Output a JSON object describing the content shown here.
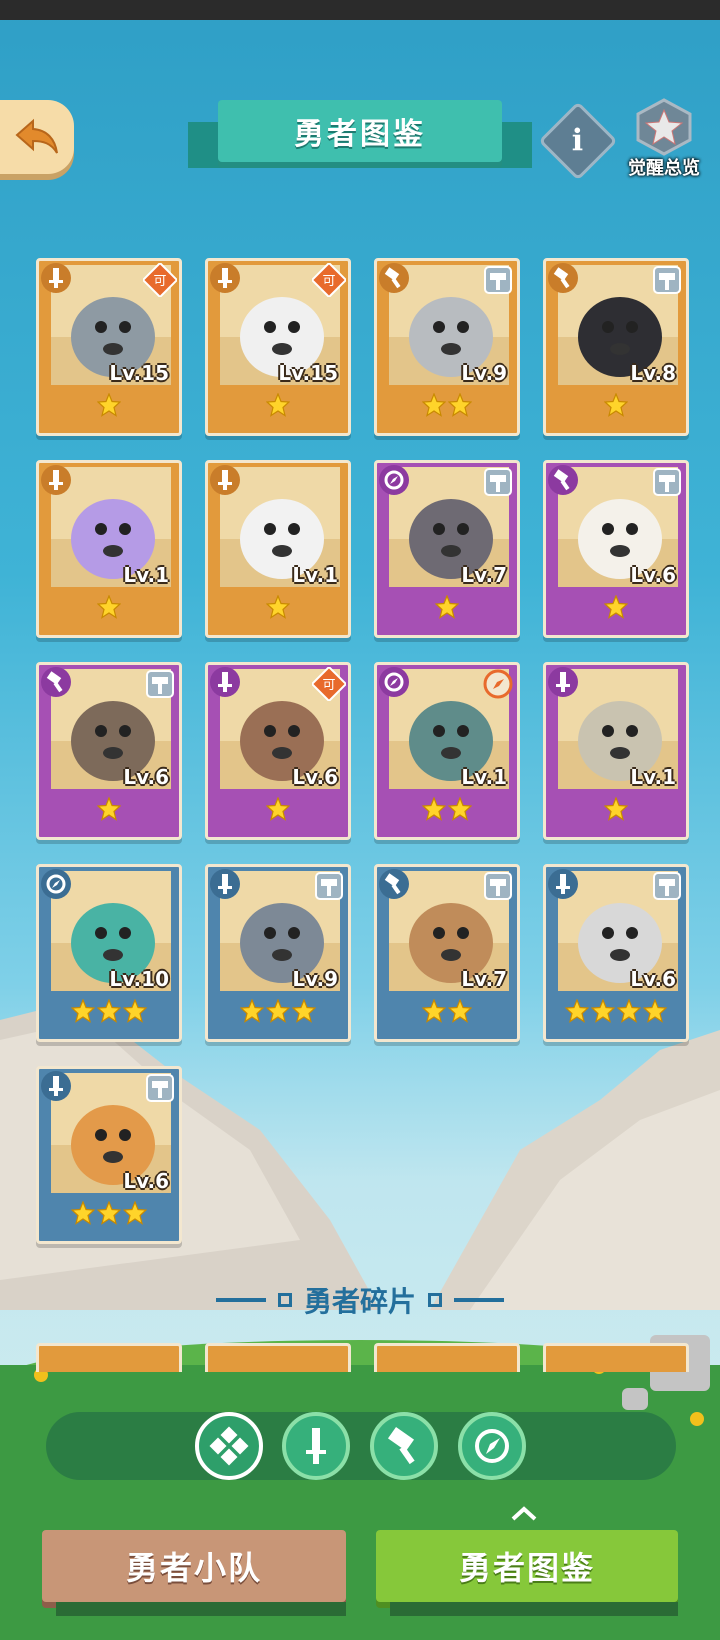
{
  "header": {
    "title": "勇者图鉴",
    "awaken_label": "觉醒总览",
    "info_label": "i"
  },
  "colors": {
    "orange_card": "#e29a3c",
    "purple_card": "#a650b4",
    "blue_card": "#4f85ad",
    "accent_teal": "#3fbfae",
    "active_tab_green": "#86c83a"
  },
  "heroes": [
    {
      "level": "Lv.15",
      "stars": 1,
      "rarity": "orange",
      "class_icon": "sword-icon",
      "tag_icon": "shield-badge-icon"
    },
    {
      "level": "Lv.15",
      "stars": 1,
      "rarity": "orange",
      "class_icon": "sword-icon",
      "tag_icon": "shield-badge-icon"
    },
    {
      "level": "Lv.9",
      "stars": 2,
      "rarity": "orange",
      "class_icon": "hammer-icon",
      "tag_icon": "hammer-badge-icon"
    },
    {
      "level": "Lv.8",
      "stars": 1,
      "rarity": "orange",
      "class_icon": "hammer-icon",
      "tag_icon": "hammer-badge-icon"
    },
    {
      "level": "Lv.1",
      "stars": 1,
      "rarity": "orange",
      "class_icon": "sword-icon",
      "tag_icon": ""
    },
    {
      "level": "Lv.1",
      "stars": 1,
      "rarity": "orange",
      "class_icon": "sword-icon",
      "tag_icon": ""
    },
    {
      "level": "Lv.7",
      "stars": 1,
      "rarity": "purple",
      "class_icon": "compass-icon",
      "tag_icon": "hammer-badge-icon"
    },
    {
      "level": "Lv.6",
      "stars": 1,
      "rarity": "purple",
      "class_icon": "hammer-icon",
      "tag_icon": "hammer-badge-icon"
    },
    {
      "level": "Lv.6",
      "stars": 1,
      "rarity": "purple",
      "class_icon": "hammer-icon",
      "tag_icon": "hammer-badge-icon"
    },
    {
      "level": "Lv.6",
      "stars": 1,
      "rarity": "purple",
      "class_icon": "sword-icon",
      "tag_icon": "shield-badge-icon"
    },
    {
      "level": "Lv.1",
      "stars": 2,
      "rarity": "purple",
      "class_icon": "compass-icon",
      "tag_icon": "compass-badge-icon"
    },
    {
      "level": "Lv.1",
      "stars": 1,
      "rarity": "purple",
      "class_icon": "sword-icon",
      "tag_icon": ""
    },
    {
      "level": "Lv.10",
      "stars": 3,
      "rarity": "blue",
      "class_icon": "compass-icon",
      "tag_icon": ""
    },
    {
      "level": "Lv.9",
      "stars": 3,
      "rarity": "blue",
      "class_icon": "sword-icon",
      "tag_icon": "hammer-badge-icon"
    },
    {
      "level": "Lv.7",
      "stars": 2,
      "rarity": "blue",
      "class_icon": "hammer-icon",
      "tag_icon": "hammer-badge-icon"
    },
    {
      "level": "Lv.6",
      "stars": 4,
      "rarity": "blue",
      "class_icon": "sword-icon",
      "tag_icon": "hammer-badge-icon"
    },
    {
      "level": "Lv.6",
      "stars": 3,
      "rarity": "blue",
      "class_icon": "sword-icon",
      "tag_icon": "hammer-badge-icon"
    }
  ],
  "shards": {
    "title": "勇者碎片"
  },
  "filters": [
    {
      "icon": "all-classes-icon",
      "active": true
    },
    {
      "icon": "sword-icon",
      "active": false
    },
    {
      "icon": "hammer-icon",
      "active": false
    },
    {
      "icon": "compass-icon",
      "active": false
    }
  ],
  "bottom_nav": {
    "team_label": "勇者小队",
    "codex_label": "勇者图鉴"
  }
}
